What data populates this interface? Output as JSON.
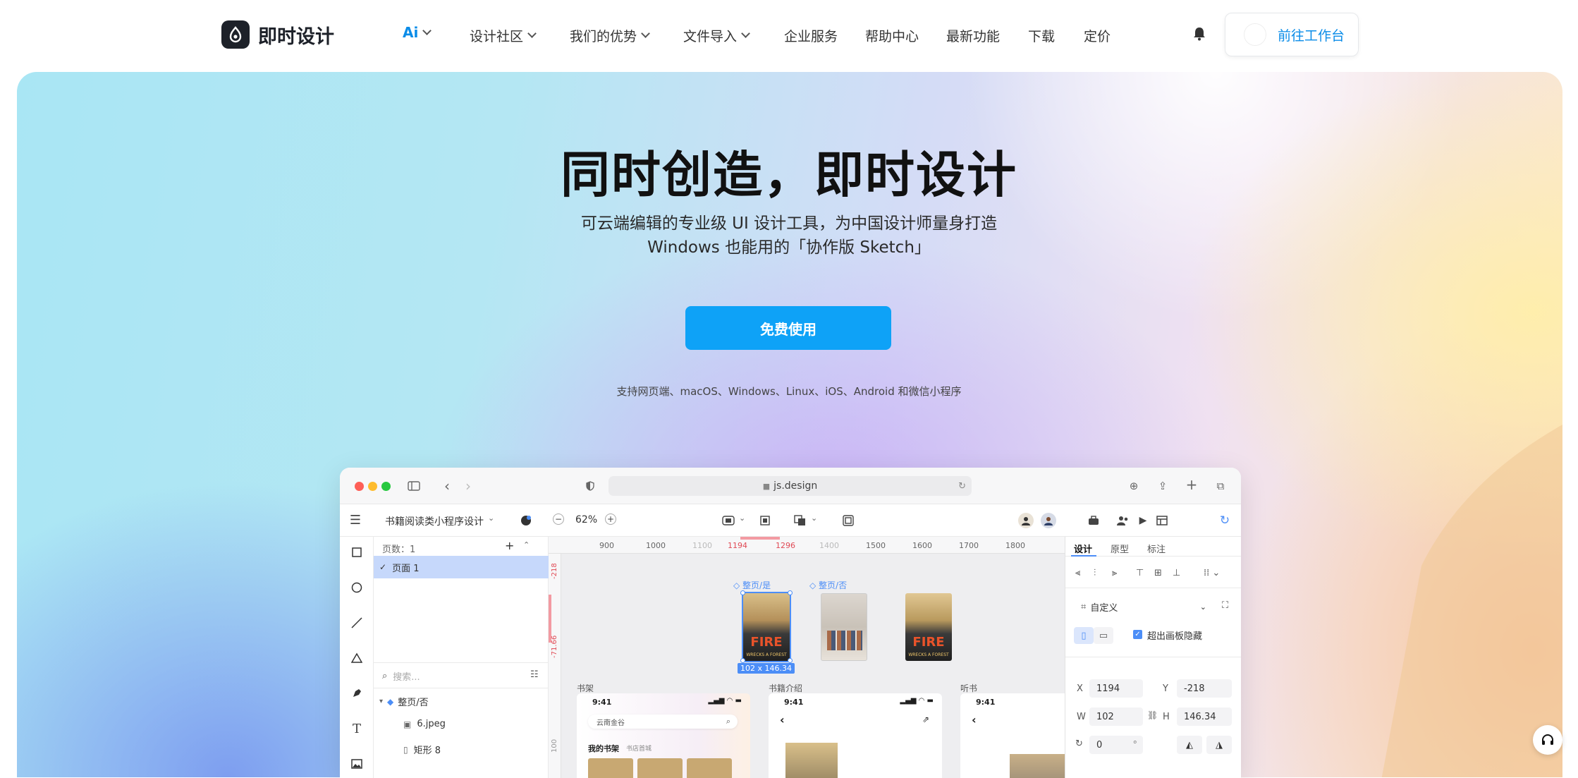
{
  "brand": {
    "name": "即时设计"
  },
  "nav": {
    "items": [
      {
        "label": "Ai",
        "has_menu": true
      },
      {
        "label": "设计社区",
        "has_menu": true
      },
      {
        "label": "我们的优势",
        "has_menu": true
      },
      {
        "label": "文件导入",
        "has_menu": true
      },
      {
        "label": "企业服务",
        "has_menu": false
      },
      {
        "label": "帮助中心",
        "has_menu": false
      },
      {
        "label": "最新功能",
        "has_menu": false
      },
      {
        "label": "下载",
        "has_menu": false
      },
      {
        "label": "定价",
        "has_menu": false
      }
    ],
    "workspace_button": "前往工作台"
  },
  "hero": {
    "title": "同时创造，即时设计",
    "subtitle_line1": "可云端编辑的专业级 UI 设计工具，为中国设计师量身打造",
    "subtitle_line2": "Windows 也能用的「协作版 Sketch」",
    "cta": "免费使用",
    "platforms": "支持网页端、macOS、Windows、Linux、iOS、Android 和微信小程序"
  },
  "app": {
    "url": "js.design",
    "file_name": "书籍阅读类小程序设计",
    "zoom": "62%",
    "pages_label": "页数：1",
    "page_item": "页面 1",
    "search_placeholder": "搜索...",
    "layers": [
      {
        "name": "整页/否",
        "type": "component"
      },
      {
        "name": "6.jpeg",
        "type": "image"
      },
      {
        "name": "矩形 8",
        "type": "rect"
      }
    ],
    "ruler_marks": [
      "900",
      "1000",
      "1100",
      "1194",
      "1296",
      "1400",
      "1500",
      "1600",
      "1700",
      "1800"
    ],
    "vruler_marks": [
      "-218",
      "-71.66",
      "100"
    ],
    "frames": [
      {
        "label": "整页/是"
      },
      {
        "label": "整页/否"
      }
    ],
    "selection_size": "102 x 146.34",
    "sections": [
      "书架",
      "书籍介绍",
      "听书"
    ],
    "phone_time": "9:41",
    "shelf_search": "云南金谷",
    "shelf_tabs": [
      "我的书架",
      "书店首城"
    ],
    "poster_text": "FIRE",
    "poster_sub": "WRECKS A FOREST",
    "props": {
      "tabs": [
        "设计",
        "原型",
        "标注"
      ],
      "frame_preset": "自定义",
      "clip_label": "超出画板隐藏",
      "x_label": "X",
      "x": "1194",
      "y_label": "Y",
      "y": "-218",
      "w_label": "W",
      "w": "102",
      "h_label": "H",
      "h": "146.34",
      "rotation": "0",
      "rotation_unit": "°"
    }
  },
  "colors": {
    "accent": "#0ea2f7",
    "link": "#0a8ce8",
    "selection": "#4c8ef7"
  }
}
